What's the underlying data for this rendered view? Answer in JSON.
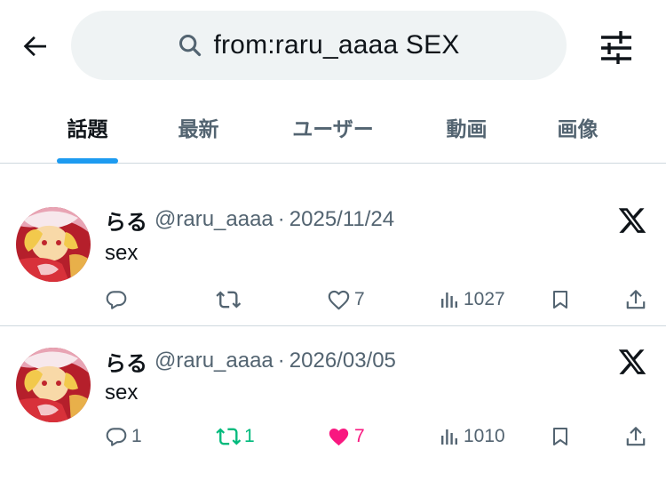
{
  "header": {
    "search": {
      "value": "from:raru_aaaa SEX"
    }
  },
  "tabs": [
    {
      "label": "話題",
      "active": true
    },
    {
      "label": "最新",
      "active": false
    },
    {
      "label": "ユーザー",
      "active": false
    },
    {
      "label": "動画",
      "active": false
    },
    {
      "label": "画像",
      "active": false
    }
  ],
  "colors": {
    "accent": "#1d9bf0",
    "retweet_active": "#00ba7c",
    "like_active": "#f91880",
    "secondary_text": "#536471"
  },
  "tweets": [
    {
      "display_name": "らる",
      "handle": "@raru_aaaa",
      "separator": "·",
      "date": "2025/11/24",
      "text": "sex",
      "replies": "",
      "retweets": "",
      "likes": "7",
      "views": "1027",
      "retweeted": false,
      "liked": false
    },
    {
      "display_name": "らる",
      "handle": "@raru_aaaa",
      "separator": "·",
      "date": "2026/03/05",
      "text": "sex",
      "replies": "1",
      "retweets": "1",
      "likes": "7",
      "views": "1010",
      "retweeted": true,
      "liked": true
    }
  ],
  "icons": {
    "back": "arrow-left-icon",
    "search": "search-icon",
    "filter": "sliders-icon",
    "reply": "reply-icon",
    "retweet": "retweet-icon",
    "like": "heart-icon",
    "views": "views-icon",
    "bookmark": "bookmark-icon",
    "share": "share-icon",
    "x_logo": "x-logo-icon"
  }
}
